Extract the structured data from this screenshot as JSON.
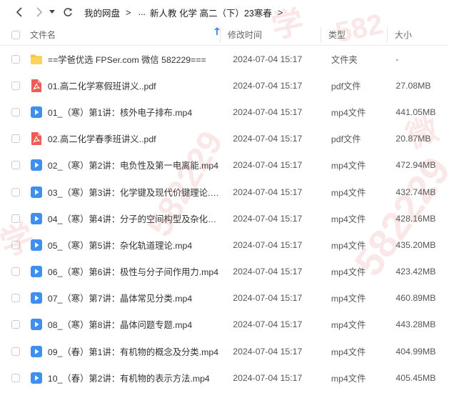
{
  "breadcrumb": {
    "items": [
      "我的网盘",
      "...",
      "新人教 化学 高二（下）23寒春"
    ]
  },
  "columns": {
    "name": "文件名",
    "time": "修改时间",
    "type": "类型",
    "size": "大小"
  },
  "files": [
    {
      "icon": "folder-icon",
      "name": "==学爸优选 FPSer.com 微信 582229===",
      "time": "2024-07-04 15:17",
      "type": "文件夹",
      "size": "-"
    },
    {
      "icon": "pdf-icon",
      "name": "01.高二化学寒假班讲义..pdf",
      "time": "2024-07-04 15:17",
      "type": "pdf文件",
      "size": "27.08MB"
    },
    {
      "icon": "video-icon",
      "name": "01_（寒）第1讲：核外电子排布.mp4",
      "time": "2024-07-04 15:17",
      "type": "mp4文件",
      "size": "441.05MB"
    },
    {
      "icon": "pdf-icon",
      "name": "02.高二化学春季班讲义..pdf",
      "time": "2024-07-04 15:17",
      "type": "pdf文件",
      "size": "20.87MB"
    },
    {
      "icon": "video-icon",
      "name": "02_（寒）第2讲：电负性及第一电离能.mp4",
      "time": "2024-07-04 15:17",
      "type": "mp4文件",
      "size": "472.94MB"
    },
    {
      "icon": "video-icon",
      "name": "03_（寒）第3讲：化学键及现代价键理论.mp4",
      "time": "2024-07-04 15:17",
      "type": "mp4文件",
      "size": "432.74MB"
    },
    {
      "icon": "video-icon",
      "name": "04_（寒）第4讲：分子的空间构型及杂化类型...",
      "time": "2024-07-04 15:17",
      "type": "mp4文件",
      "size": "428.16MB"
    },
    {
      "icon": "video-icon",
      "name": "05_（寒）第5讲：杂化轨道理论.mp4",
      "time": "2024-07-04 15:17",
      "type": "mp4文件",
      "size": "435.20MB"
    },
    {
      "icon": "video-icon",
      "name": "06_（寒）第6讲：极性与分子间作用力.mp4",
      "time": "2024-07-04 15:17",
      "type": "mp4文件",
      "size": "423.42MB"
    },
    {
      "icon": "video-icon",
      "name": "07_（寒）第7讲：晶体常见分类.mp4",
      "time": "2024-07-04 15:17",
      "type": "mp4文件",
      "size": "460.89MB"
    },
    {
      "icon": "video-icon",
      "name": "08_（寒）第8讲：晶体问题专题.mp4",
      "time": "2024-07-04 15:17",
      "type": "mp4文件",
      "size": "443.28MB"
    },
    {
      "icon": "video-icon",
      "name": "09_（春）第1讲：有机物的概念及分类.mp4",
      "time": "2024-07-04 15:17",
      "type": "mp4文件",
      "size": "404.99MB"
    },
    {
      "icon": "video-icon",
      "name": "10_（春）第2讲：有机物的表示方法.mp4",
      "time": "2024-07-04 15:17",
      "type": "mp4文件",
      "size": "405.45MB"
    }
  ],
  "colors": {
    "accent": "#4a8cf4",
    "folder": "#f7c33d",
    "pdf": "#ef5b55",
    "video": "#3e8ff0"
  }
}
